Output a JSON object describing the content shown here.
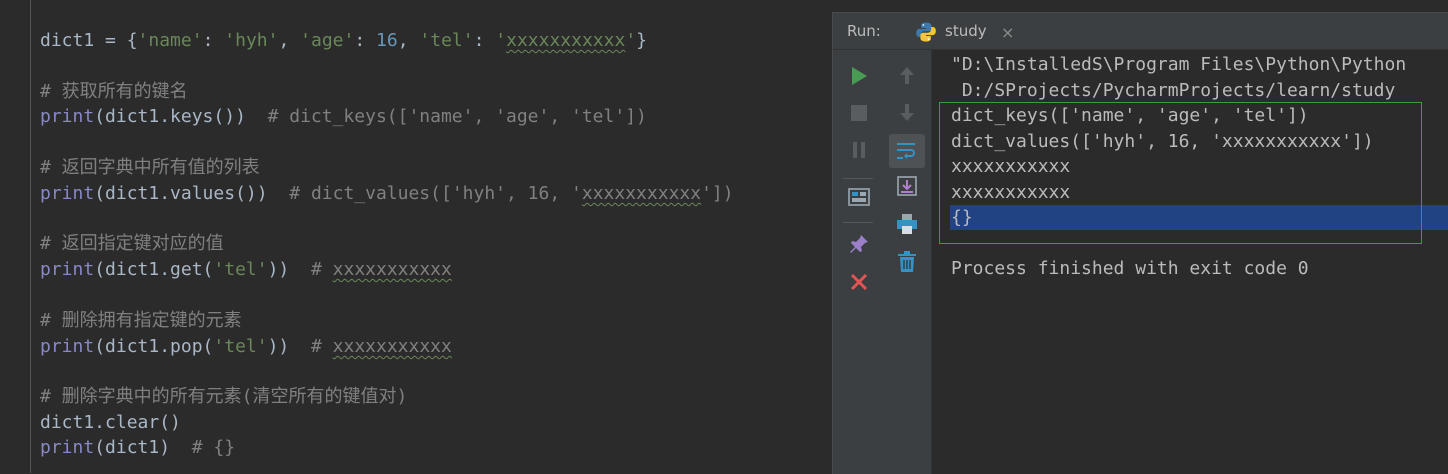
{
  "editor": {
    "lines": [
      {
        "segments": [
          {
            "t": "dict1 = {",
            "c": "plain"
          },
          {
            "t": "'name'",
            "c": "str"
          },
          {
            "t": ": ",
            "c": "plain"
          },
          {
            "t": "'hyh'",
            "c": "str"
          },
          {
            "t": ", ",
            "c": "plain"
          },
          {
            "t": "'age'",
            "c": "str"
          },
          {
            "t": ": ",
            "c": "plain"
          },
          {
            "t": "16",
            "c": "num"
          },
          {
            "t": ", ",
            "c": "plain"
          },
          {
            "t": "'tel'",
            "c": "str"
          },
          {
            "t": ": ",
            "c": "plain"
          },
          {
            "t": "'",
            "c": "str"
          },
          {
            "t": "xxxxxxxxxxx",
            "c": "str squig"
          },
          {
            "t": "'",
            "c": "str"
          },
          {
            "t": "}",
            "c": "plain"
          }
        ]
      },
      {
        "segments": [
          {
            "t": "# 获取所有的键名",
            "c": "cmt"
          }
        ]
      },
      {
        "segments": [
          {
            "t": "print",
            "c": "kw-fn"
          },
          {
            "t": "(dict1.keys())  ",
            "c": "plain"
          },
          {
            "t": "# dict_keys(['name', 'age', 'tel'])",
            "c": "cmt"
          }
        ]
      },
      {
        "segments": [
          {
            "t": "# 返回字典中所有值的列表",
            "c": "cmt"
          }
        ]
      },
      {
        "segments": [
          {
            "t": "print",
            "c": "kw-fn"
          },
          {
            "t": "(dict1.values())  ",
            "c": "plain"
          },
          {
            "t": "# dict_values(['hyh', 16, '",
            "c": "cmt"
          },
          {
            "t": "xxxxxxxxxxx",
            "c": "cmt squig-c"
          },
          {
            "t": "'])",
            "c": "cmt"
          }
        ]
      },
      {
        "segments": [
          {
            "t": "# 返回指定键对应的值",
            "c": "cmt"
          }
        ]
      },
      {
        "segments": [
          {
            "t": "print",
            "c": "kw-fn"
          },
          {
            "t": "(dict1.get(",
            "c": "plain"
          },
          {
            "t": "'tel'",
            "c": "str"
          },
          {
            "t": "))  ",
            "c": "plain"
          },
          {
            "t": "# ",
            "c": "cmt"
          },
          {
            "t": "xxxxxxxxxxx",
            "c": "cmt squig-c"
          }
        ]
      },
      {
        "segments": [
          {
            "t": "# 删除拥有指定键的元素",
            "c": "cmt"
          }
        ]
      },
      {
        "segments": [
          {
            "t": "print",
            "c": "kw-fn"
          },
          {
            "t": "(dict1.pop(",
            "c": "plain"
          },
          {
            "t": "'tel'",
            "c": "str"
          },
          {
            "t": "))  ",
            "c": "plain"
          },
          {
            "t": "# ",
            "c": "cmt"
          },
          {
            "t": "xxxxxxxxxxx",
            "c": "cmt squig-c"
          }
        ]
      },
      {
        "segments": [
          {
            "t": "# 删除字典中的所有元素(清空所有的键值对)",
            "c": "cmt"
          }
        ]
      },
      {
        "segments": [
          {
            "t": "dict1.clear()",
            "c": "plain"
          }
        ]
      },
      {
        "segments": [
          {
            "t": "print",
            "c": "kw-fn"
          },
          {
            "t": "(dict1)  ",
            "c": "plain"
          },
          {
            "t": "# {}",
            "c": "cmt"
          }
        ]
      }
    ]
  },
  "run_panel": {
    "label": "Run:",
    "tab": {
      "label": "study",
      "close": "×"
    },
    "console_lines": [
      "\"D:\\InstalledS\\Program Files\\Python\\Python",
      " D:/SProjects/PycharmProjects/learn/study",
      "dict_keys(['name', 'age', 'tel'])",
      "dict_values(['hyh', 16, 'xxxxxxxxxxx'])",
      "xxxxxxxxxxx",
      "xxxxxxxxxxx",
      "{}",
      "",
      "Process finished with exit code 0"
    ]
  },
  "colors": {
    "background": "#2b2b2b",
    "panel": "#3c3f41",
    "selection": "#214283",
    "run_green": "#499c54",
    "stop_red": "#c75450"
  },
  "icons": [
    "python-icon",
    "close-icon",
    "run-icon",
    "stop-icon",
    "pause-icon",
    "layout-icon",
    "pin-icon",
    "close-red-icon",
    "up-arrow-icon",
    "down-arrow-icon",
    "soft-wrap-icon",
    "scroll-to-end-icon",
    "print-icon",
    "trash-icon"
  ]
}
